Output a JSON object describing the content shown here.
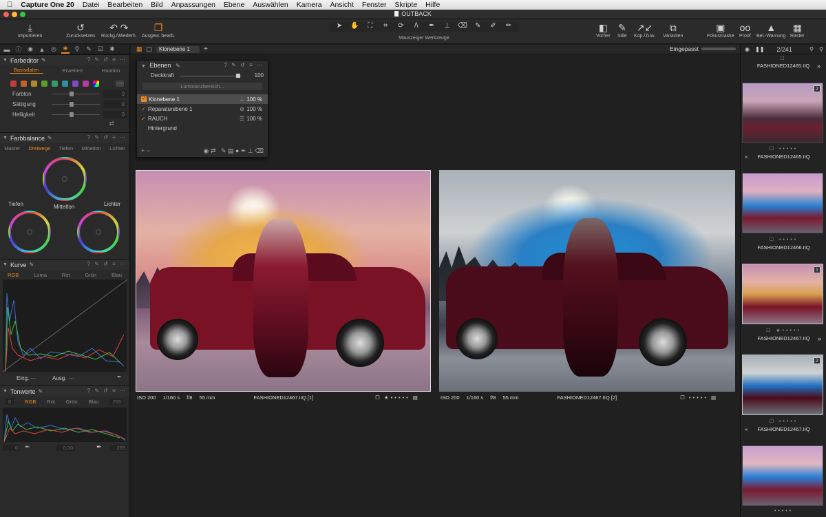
{
  "menubar": {
    "app_name": "Capture One 20",
    "items": [
      "Datei",
      "Bearbeiten",
      "Bild",
      "Anpassungen",
      "Ebene",
      "Auswählen",
      "Kamera",
      "Ansicht",
      "Fenster",
      "Skripte",
      "Hilfe"
    ]
  },
  "window": {
    "title": "OUTBACK"
  },
  "toolbar": {
    "import": "Importieren",
    "reset": "Zurücksetzen",
    "undo_redo": "Rückg./Wiederh.",
    "edit_selected": "Ausgew. bearb.",
    "cursor_tools": "Mauszeiger Werkzeuge",
    "before": "Vorher",
    "styles": "Stile",
    "copy_apply": "Kop./Zuw.",
    "variants": "Varianten",
    "focus_mask": "Fokusmaske",
    "proof": "Proof",
    "exposure_warning": "Bel.-Warnung",
    "grid": "Raster"
  },
  "color_editor": {
    "title": "Farbeditor",
    "tabs": [
      "Basisdaten",
      "Erweitert",
      "Hautton"
    ],
    "swatch_colors": [
      "#c23a3a",
      "#c0622d",
      "#b08a2a",
      "#5f9a2c",
      "#2f9a6a",
      "#2f8da0",
      "#7a4cc0",
      "#b03aa0"
    ],
    "sliders": [
      {
        "label": "Farbton",
        "value": "0"
      },
      {
        "label": "Sättigung",
        "value": "0"
      },
      {
        "label": "Helligkeit",
        "value": "0"
      }
    ]
  },
  "color_balance": {
    "title": "Farbbalance",
    "tabs": [
      "Master",
      "Dreiwege",
      "Tiefen",
      "Mittelton",
      "Lichter"
    ],
    "shadows": "Tiefen",
    "midtone": "Mittelton",
    "highlights": "Lichter"
  },
  "curve": {
    "title": "Kurve",
    "tabs": [
      "RGB",
      "Luma",
      "Rot",
      "Grün",
      "Blau"
    ],
    "input": "Eing.",
    "input_val": "---",
    "output": "Ausg.",
    "output_val": "---"
  },
  "levels": {
    "title": "Tonwerte",
    "tabs": [
      "RGB",
      "Rot",
      "Grün",
      "Blau"
    ],
    "min": "0",
    "max": "255",
    "low": "0",
    "mid": "0,00",
    "high": "255"
  },
  "viewer": {
    "layer_select": "Klonebene 1",
    "zoom": "Eingepasst"
  },
  "layers": {
    "title": "Ebenen",
    "opacity_label": "Deckkraft",
    "opacity_value": "100",
    "luminance": "Luminanzbereich...",
    "rows": [
      {
        "name": "Klonebene 1",
        "pct": "100 %",
        "active": true
      },
      {
        "name": "Reparaturebene 1",
        "pct": "100 %"
      },
      {
        "name": "RAUCH",
        "pct": "100 %"
      },
      {
        "name": "Hintergrund",
        "pct": ""
      }
    ]
  },
  "photos": {
    "left": {
      "iso": "ISO 200",
      "shutter": "1/160 s",
      "aperture": "f/8",
      "focal": "55 mm",
      "name": "FASHIONED12467.IIQ [1]"
    },
    "right": {
      "iso": "ISO 200",
      "shutter": "1/160 s",
      "aperture": "f/8",
      "focal": "55 mm",
      "name": "FASHIONED12467.IIQ [2]"
    }
  },
  "browser": {
    "count": "2/241",
    "thumbs": [
      {
        "label": "FASHIONED12465.IIQ",
        "badge": "2"
      },
      {
        "label": "FASHIONED12465.IIQ",
        "badge": ""
      },
      {
        "label": "FASHIONED12466.IIQ",
        "badge": "1"
      },
      {
        "label": "FASHIONED12467.IIQ",
        "badge": "2"
      },
      {
        "label": "FASHIONED12467.IIQ",
        "badge": ""
      }
    ]
  }
}
